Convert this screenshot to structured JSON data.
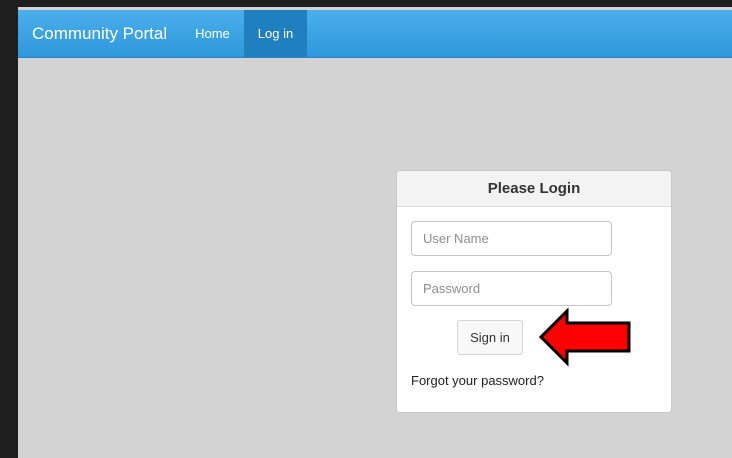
{
  "navbar": {
    "brand": "Community Portal",
    "items": [
      {
        "label": "Home",
        "active": false
      },
      {
        "label": "Log in",
        "active": true
      }
    ],
    "color": "#3aa3e6"
  },
  "login_panel": {
    "title": "Please Login",
    "username_placeholder": "User Name",
    "password_placeholder": "Password",
    "signin_label": "Sign in",
    "forgot_link": "Forgot your password?"
  },
  "annotation": {
    "icon": "red-arrow-icon",
    "color": "#ff0000"
  }
}
